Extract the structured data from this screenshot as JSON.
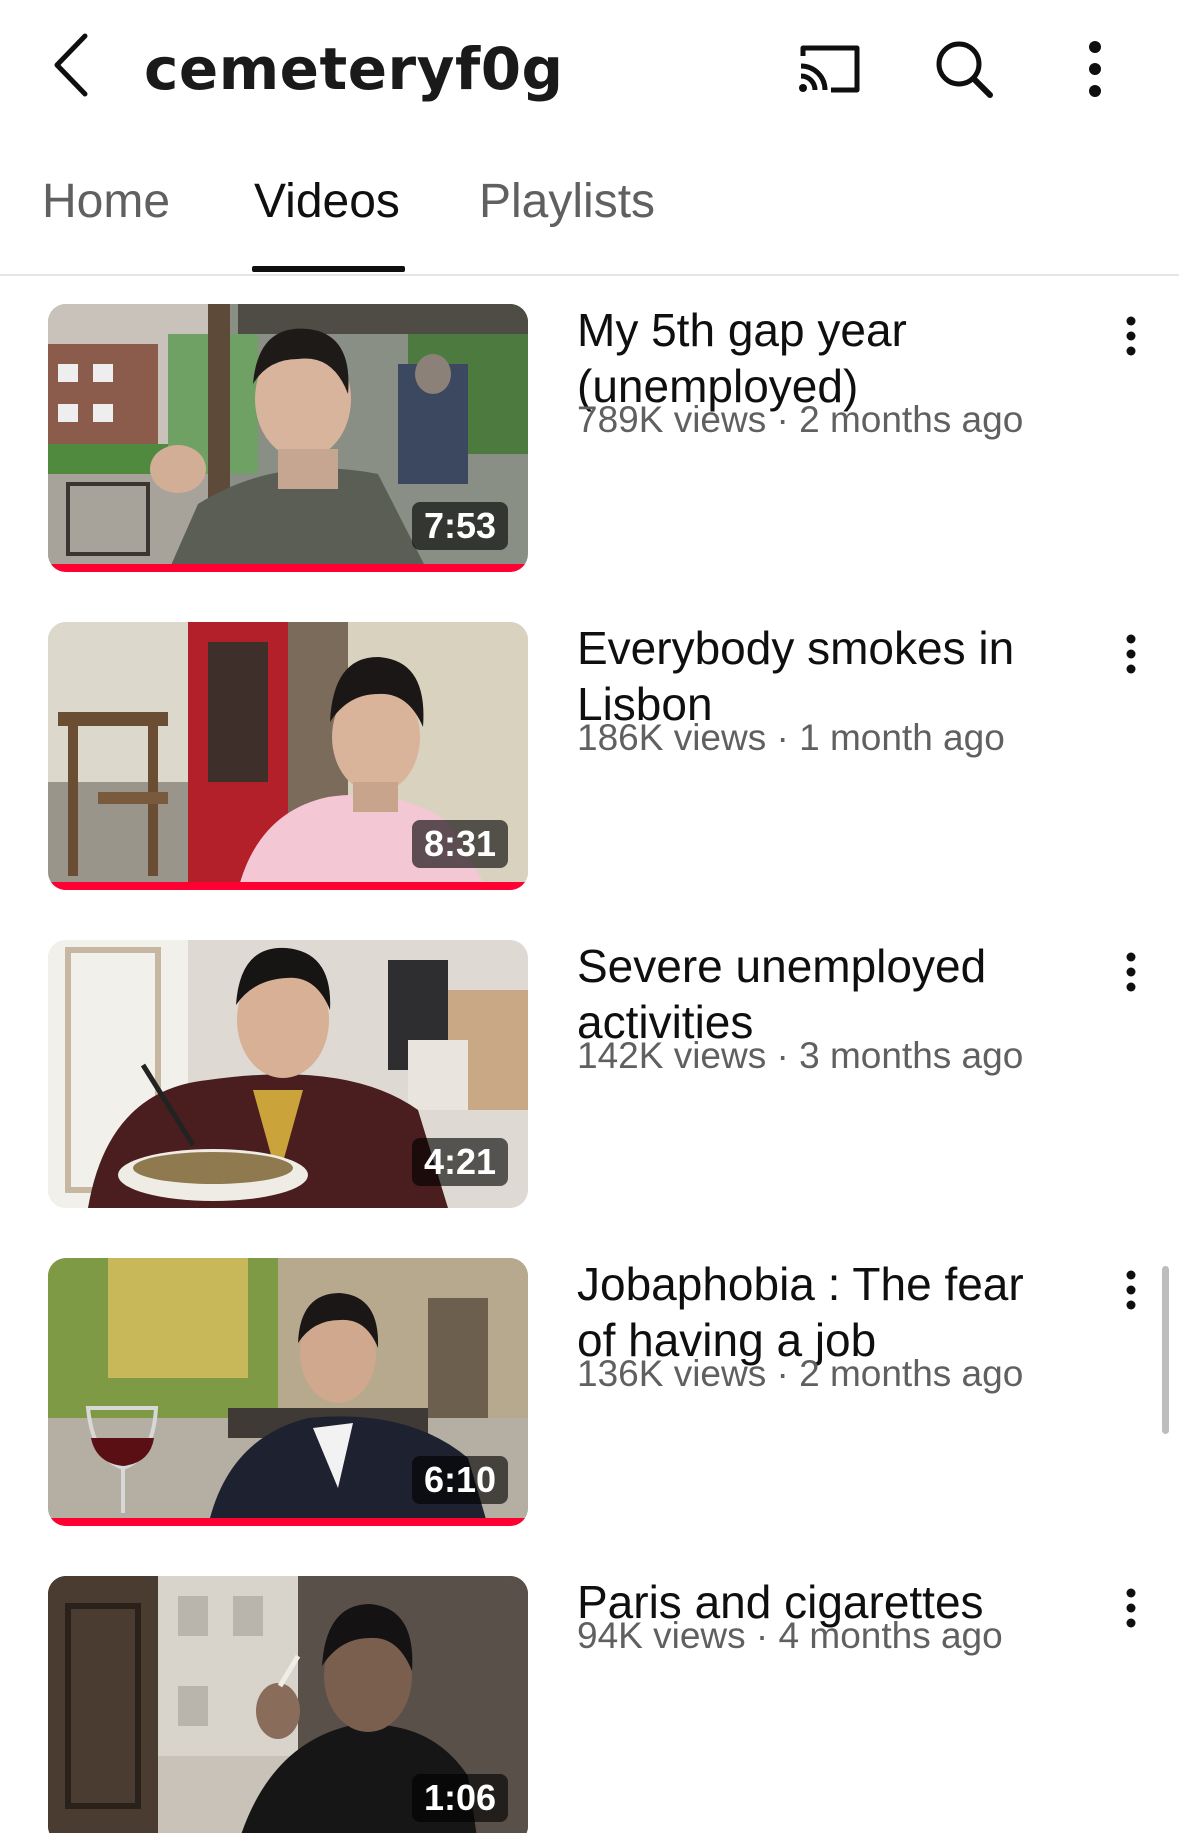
{
  "header": {
    "channel_name": "cemeteryf0g",
    "icons": [
      "back-icon",
      "cast-icon",
      "search-icon",
      "more-vert-icon"
    ]
  },
  "tabs": [
    {
      "label": "Home",
      "active": false
    },
    {
      "label": "Videos",
      "active": true
    },
    {
      "label": "Playlists",
      "active": false
    }
  ],
  "videos": [
    {
      "title": "My 5th gap year (unemployed)",
      "views": "789K views",
      "age": "2 months ago",
      "meta": "789K views · 2 months ago",
      "duration": "7:53",
      "watched": true
    },
    {
      "title": "Everybody smokes in Lisbon",
      "views": "186K views",
      "age": "1 month ago",
      "meta": "186K views · 1 month ago",
      "duration": "8:31",
      "watched": true
    },
    {
      "title": "Severe unemployed activities",
      "views": "142K views",
      "age": "3 months ago",
      "meta": "142K views · 3 months ago",
      "duration": "4:21",
      "watched": false
    },
    {
      "title": "Jobaphobia : The fear of having a job",
      "views": "136K views",
      "age": "2 months ago",
      "meta": "136K views · 2 months ago",
      "duration": "6:10",
      "watched": true
    },
    {
      "title": "Paris and cigarettes",
      "views": "94K views",
      "age": "4 months ago",
      "meta": "94K views · 4 months ago",
      "duration": "1:06",
      "watched": false
    }
  ],
  "colors": {
    "accent_progress": "#ff0033",
    "text_primary": "#0f0f0f",
    "text_secondary": "#606060"
  }
}
